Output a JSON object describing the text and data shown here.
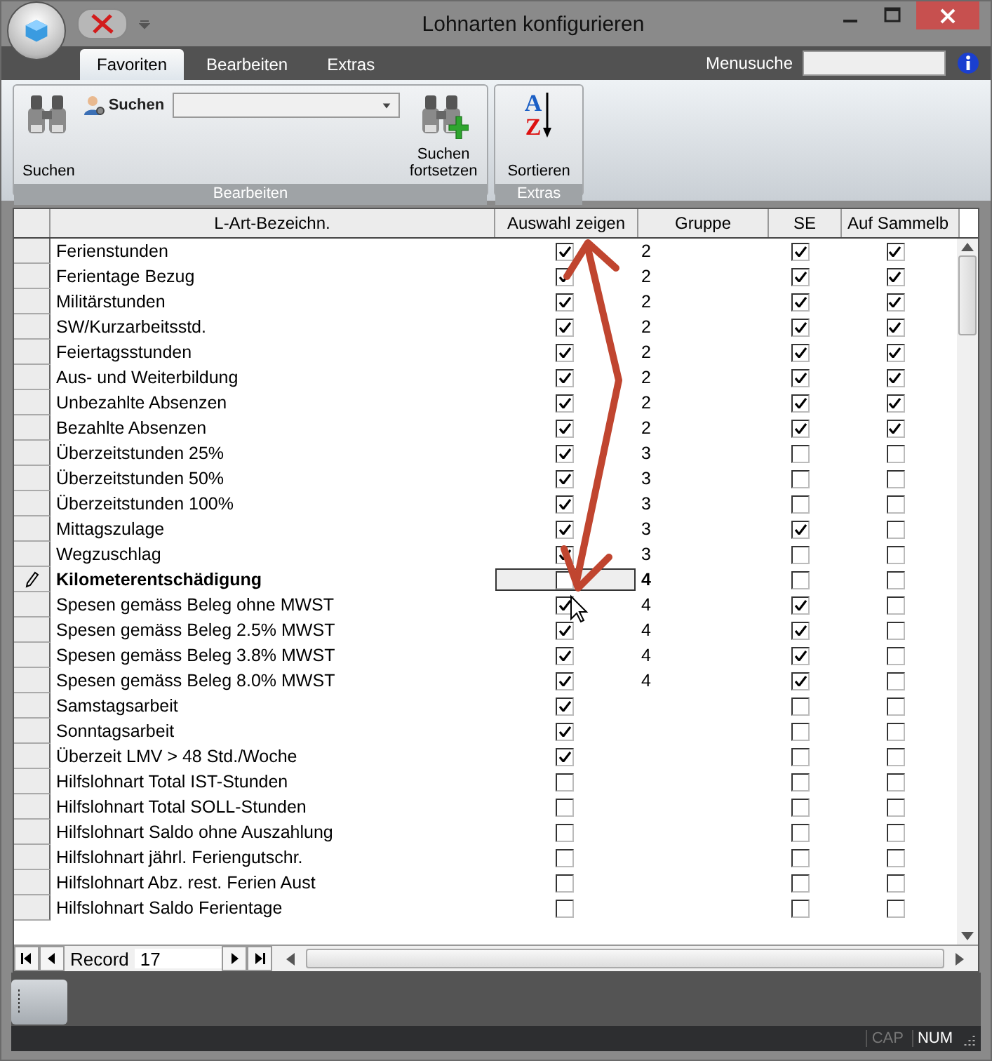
{
  "window": {
    "title": "Lohnarten konfigurieren"
  },
  "tabs": [
    {
      "label": "Favoriten",
      "selected": true
    },
    {
      "label": "Bearbeiten",
      "selected": false
    },
    {
      "label": "Extras",
      "selected": false
    }
  ],
  "menu_search": {
    "label": "Menusuche"
  },
  "ribbon": {
    "groups": [
      {
        "label": "Bearbeiten",
        "items": [
          {
            "kind": "search",
            "label": "Suchen"
          },
          {
            "kind": "combo",
            "label": "Suchen"
          },
          {
            "kind": "continue",
            "label": "Suchen fortsetzen"
          }
        ]
      },
      {
        "label": "Extras",
        "items": [
          {
            "kind": "sort",
            "glyphs": [
              "A",
              "Z"
            ],
            "label": "Sortieren"
          }
        ]
      }
    ]
  },
  "table": {
    "columns": [
      "L-Art-Bezeichn.",
      "Auswahl zeigen",
      "Gruppe",
      "SE",
      "Auf Sammelb"
    ],
    "rows": [
      {
        "name": "Ferienstunden",
        "current": false,
        "show": true,
        "group": "2",
        "se": true,
        "sammel": true
      },
      {
        "name": "Ferientage Bezug",
        "current": false,
        "show": true,
        "group": "2",
        "se": true,
        "sammel": true
      },
      {
        "name": "Militärstunden",
        "current": false,
        "show": true,
        "group": "2",
        "se": true,
        "sammel": true
      },
      {
        "name": "SW/Kurzarbeitsstd.",
        "current": false,
        "show": true,
        "group": "2",
        "se": true,
        "sammel": true
      },
      {
        "name": "Feiertagsstunden",
        "current": false,
        "show": true,
        "group": "2",
        "se": true,
        "sammel": true
      },
      {
        "name": "Aus- und Weiterbildung",
        "current": false,
        "show": true,
        "group": "2",
        "se": true,
        "sammel": true
      },
      {
        "name": "Unbezahlte Absenzen",
        "current": false,
        "show": true,
        "group": "2",
        "se": true,
        "sammel": true
      },
      {
        "name": "Bezahlte Absenzen",
        "current": false,
        "show": true,
        "group": "2",
        "se": true,
        "sammel": true
      },
      {
        "name": "Überzeitstunden 25%",
        "current": false,
        "show": true,
        "group": "3",
        "se": false,
        "sammel": false
      },
      {
        "name": "Überzeitstunden 50%",
        "current": false,
        "show": true,
        "group": "3",
        "se": false,
        "sammel": false
      },
      {
        "name": "Überzeitstunden 100%",
        "current": false,
        "show": true,
        "group": "3",
        "se": false,
        "sammel": false
      },
      {
        "name": "Mittagszulage",
        "current": false,
        "show": true,
        "group": "3",
        "se": true,
        "sammel": false
      },
      {
        "name": "Wegzuschlag",
        "current": false,
        "show": true,
        "group": "3",
        "se": false,
        "sammel": false
      },
      {
        "name": "Kilometerentschädigung",
        "current": true,
        "show": false,
        "group": "4",
        "se": false,
        "sammel": false
      },
      {
        "name": "Spesen gemäss Beleg ohne MWST",
        "current": false,
        "show": true,
        "group": "4",
        "se": true,
        "sammel": false
      },
      {
        "name": "Spesen gemäss Beleg 2.5% MWST",
        "current": false,
        "show": true,
        "group": "4",
        "se": true,
        "sammel": false
      },
      {
        "name": "Spesen gemäss Beleg 3.8% MWST",
        "current": false,
        "show": true,
        "group": "4",
        "se": true,
        "sammel": false
      },
      {
        "name": "Spesen gemäss Beleg 8.0% MWST",
        "current": false,
        "show": true,
        "group": "4",
        "se": true,
        "sammel": false
      },
      {
        "name": "Samstagsarbeit",
        "current": false,
        "show": true,
        "se": false,
        "sammel": false
      },
      {
        "name": "Sonntagsarbeit",
        "current": false,
        "show": true,
        "se": false,
        "sammel": false
      },
      {
        "name": "Überzeit LMV > 48 Std./Woche",
        "current": false,
        "show": true,
        "se": false,
        "sammel": false
      },
      {
        "name": "Hilfslohnart Total IST-Stunden",
        "current": false,
        "show": false,
        "se": false,
        "sammel": false
      },
      {
        "name": "Hilfslohnart Total SOLL-Stunden",
        "current": false,
        "show": false,
        "se": false,
        "sammel": false
      },
      {
        "name": "Hilfslohnart Saldo ohne Auszahlung",
        "current": false,
        "show": false,
        "se": false,
        "sammel": false
      },
      {
        "name": "Hilfslohnart jährl. Feriengutschr.",
        "current": false,
        "show": false,
        "se": false,
        "sammel": false
      },
      {
        "name": "Hilfslohnart Abz. rest. Ferien Aust",
        "current": false,
        "show": false,
        "se": false,
        "sammel": false
      },
      {
        "name": "Hilfslohnart Saldo Ferientage",
        "current": false,
        "show": false,
        "se": false,
        "sammel": false
      }
    ]
  },
  "navigator": {
    "label": "Record",
    "value": "17"
  },
  "status": [
    {
      "label": "CAP",
      "on": false
    },
    {
      "label": "NUM",
      "on": true
    }
  ]
}
